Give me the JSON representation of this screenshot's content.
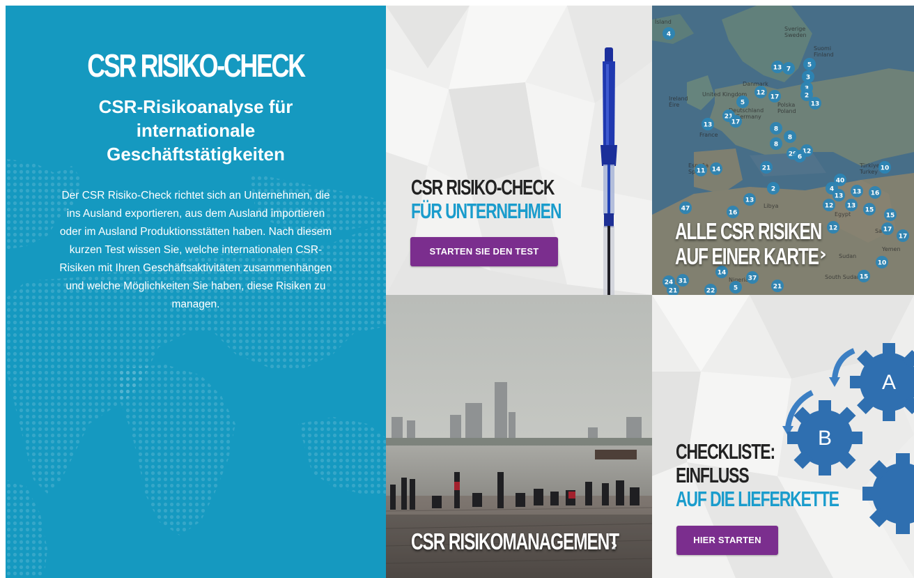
{
  "intro": {
    "title": "CSR RISIKO-CHECK",
    "subtitle": "CSR-Risikoanalyse für internationale Geschäftstätigkeiten",
    "body": "Der CSR Risiko-Check richtet sich an Unternehmen, die ins Ausland exportieren, aus dem Ausland importieren oder im Ausland Produktionsstätten haben. Nach diesem kurzen Test wissen Sie, welche internationalen CSR-Risiken mit Ihren Geschäftsaktivitäten zusammenhängen und welche Möglichkeiten Sie haben, diese Risiken zu managen."
  },
  "tiles": {
    "check": {
      "line1": "CSR RISIKO-CHECK",
      "line2": "FÜR UNTERNEHMEN",
      "button": "STARTEN SIE DEN TEST"
    },
    "map": {
      "line1": "ALLE CSR RISIKEN",
      "line2": "AUF EINER KARTE",
      "chevron": "›",
      "labels": [
        "Ísland",
        "Sverige",
        "Sweden",
        "Suomi",
        "Finland",
        "Ireland",
        "Éire",
        "United Kingdom",
        "Danmark",
        "Deutschland",
        "Germany",
        "Polska",
        "Poland",
        "France",
        "España",
        "Spain",
        "Türkiye",
        "Turkey",
        "Egypt",
        "Libya",
        "Sudan",
        "Nigeria",
        "South Sudan",
        "Yemen",
        "Saudi"
      ],
      "markers": [
        4,
        13,
        7,
        5,
        3,
        3,
        2,
        13,
        17,
        12,
        5,
        21,
        17,
        13,
        8,
        8,
        8,
        29,
        12,
        21,
        11,
        14,
        13,
        2,
        6,
        47,
        16,
        4,
        13,
        13,
        40,
        12,
        13,
        16,
        10,
        15,
        17,
        15,
        17,
        12,
        10,
        15,
        14,
        22,
        37,
        21,
        24,
        21,
        31,
        5
      ]
    },
    "management": {
      "line1": "CSR RISIKOMANAGEMENT",
      "chevron": "›"
    },
    "checklist": {
      "line1": "CHECKLISTE:",
      "line2": "EINFLUSS",
      "line3": "AUF DIE LIEFERKETTE",
      "button": "HIER STARTEN",
      "gear_a": "A",
      "gear_b": "B"
    }
  },
  "colors": {
    "teal": "#1599c0",
    "accent_blue": "#1a9ccc",
    "button_purple": "#7b2e8e",
    "gear_blue": "#2f6fb0",
    "marker_blue": "#2b84b5"
  },
  "icons": {
    "pen": "blue-ballpoint-pen",
    "gears": "gear-icons",
    "chevron": "chevron-right-icon"
  }
}
